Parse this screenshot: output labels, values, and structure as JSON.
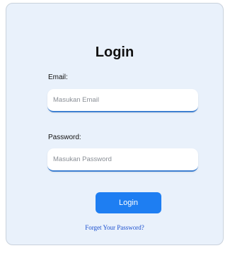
{
  "login": {
    "title": "Login",
    "email_label": "Email:",
    "email_placeholder": "Masukan Email",
    "email_value": "",
    "password_label": "Password:",
    "password_placeholder": "Masukan Password",
    "password_value": "",
    "submit_label": "Login",
    "forgot_link": "Forget Your Password?"
  },
  "colors": {
    "card_background": "#e9f1fb",
    "accent": "#1e7ef2",
    "link": "#1a4fcf"
  }
}
